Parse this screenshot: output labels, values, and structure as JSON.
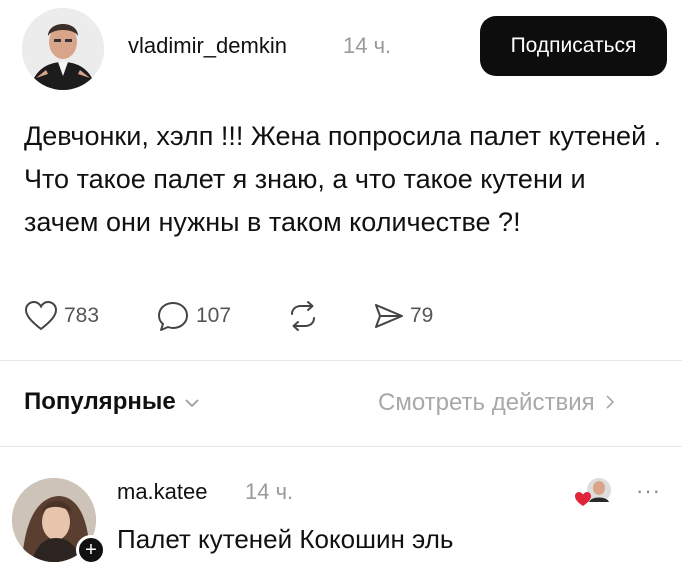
{
  "post": {
    "username": "vladimir_demkin",
    "time": "14 ч.",
    "subscribe_label": "Подписаться",
    "text": "Девчонки, хэлп !!! Жена попросила палет кутеней . Что такое палет я знаю, а что такое кутени и зачем они нужны в таком количестве ?!"
  },
  "actions": {
    "likes": "783",
    "comments": "107",
    "shares": "79"
  },
  "comments_section": {
    "sort_label": "Популярные",
    "activity_label": "Смотреть действия"
  },
  "comment": {
    "username": "ma.katee",
    "time": "14 ч.",
    "text": "Палет кутеней Кокошин эль",
    "more": "···"
  },
  "icons": {
    "like": "heart-icon",
    "comment": "comment-bubble-icon",
    "repost": "repost-icon",
    "share": "send-icon",
    "chevron_down": "chevron-down-icon",
    "chevron_right": "chevron-right-icon",
    "follow_plus": "plus-icon",
    "more": "more-icon"
  },
  "colors": {
    "button_bg": "#0d0d0d",
    "muted_text": "#9a9a9a",
    "heart_red": "#e0243a"
  }
}
